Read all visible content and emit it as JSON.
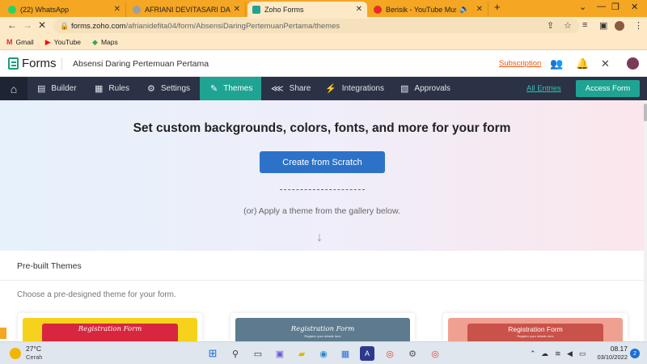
{
  "browser": {
    "tabs": [
      {
        "label": "(22) WhatsApp",
        "favicon": "whatsapp-icon",
        "color": "#25d366"
      },
      {
        "label": "AFRIANI DEVITASARI DAMULAWAN",
        "favicon": "drive-icon",
        "color": "#9aa0a6"
      },
      {
        "label": "Zoho Forms",
        "favicon": "zoho-forms-icon",
        "color": "#1fa493"
      },
      {
        "label": "Berisik - YouTube Music",
        "favicon": "youtube-music-icon",
        "color": "#e52d27"
      }
    ],
    "new_tab": "+",
    "url_host": "forms.zoho.com",
    "url_path": "/afrianidefita04/form/AbsensiDaringPertemuanPertama/themes",
    "bookmarks": [
      {
        "label": "Gmail",
        "icon": "gmail-icon"
      },
      {
        "label": "YouTube",
        "icon": "youtube-icon"
      },
      {
        "label": "Maps",
        "icon": "maps-icon"
      }
    ]
  },
  "app": {
    "brand": "Forms",
    "form_name": "Absensi Daring Pertemuan Pertama",
    "subscription": "Subscription",
    "nav": [
      {
        "label": "Builder",
        "icon": "builder-icon"
      },
      {
        "label": "Rules",
        "icon": "rules-icon"
      },
      {
        "label": "Settings",
        "icon": "gear-icon"
      },
      {
        "label": "Themes",
        "icon": "brush-icon"
      },
      {
        "label": "Share",
        "icon": "share-icon"
      },
      {
        "label": "Integrations",
        "icon": "plug-icon"
      },
      {
        "label": "Approvals",
        "icon": "approvals-icon"
      }
    ],
    "all_entries": "All Entries",
    "access_form": "Access Form",
    "accent_color": "#1fa493"
  },
  "hero": {
    "title": "Set custom backgrounds, colors, fonts, and more for your form",
    "create_button": "Create from Scratch",
    "apply_text": "(or) Apply a theme from the gallery below."
  },
  "themes": {
    "section_title": "Pre-built Themes",
    "section_subtitle": "Choose a pre-designed theme for your form.",
    "cards": [
      {
        "title": "Registration Form",
        "subtitle": "",
        "bg": "#f6d21c",
        "banner": "#d9263f"
      },
      {
        "title": "Registration Form",
        "subtitle": "Register your details here",
        "bg": "#5d7a8e",
        "banner": "#5d7a8e"
      },
      {
        "title": "Registration Form",
        "subtitle": "Register your details here",
        "bg": "#f0a091",
        "banner": "#c9524a"
      }
    ]
  },
  "taskbar": {
    "temperature": "27°C",
    "condition": "Cerah",
    "time": "08.17",
    "date": "03/10/2022",
    "notifications": "2"
  }
}
